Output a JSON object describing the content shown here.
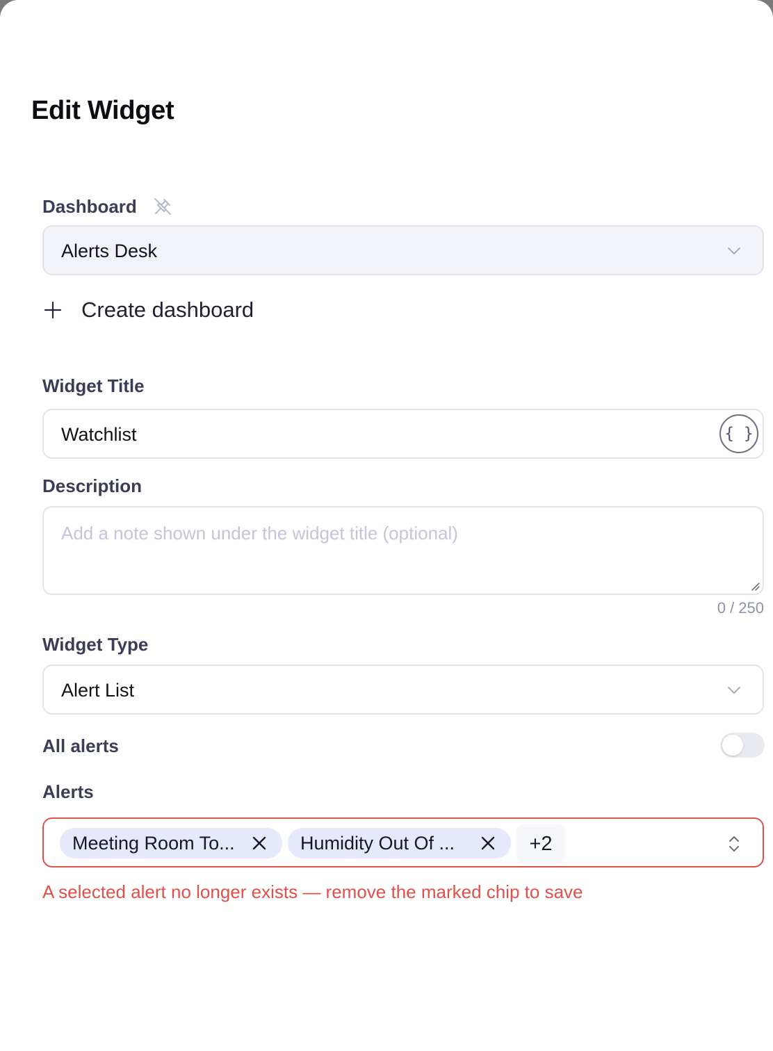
{
  "header": {
    "title": "Edit Widget"
  },
  "dashboard": {
    "label": "Dashboard",
    "label_icon": "unpin-icon",
    "selected": "Alerts Desk",
    "create_label": "Create dashboard"
  },
  "widget_title": {
    "label": "Widget Title",
    "value": "Watchlist",
    "variables_button": "{ }"
  },
  "description": {
    "label": "Description",
    "placeholder": "Add a note shown under the widget title (optional)",
    "counter": "0 / 250"
  },
  "widget_type": {
    "label": "Widget Type",
    "selected": "Alert List"
  },
  "all_alerts": {
    "label": "All alerts",
    "enabled": false
  },
  "alerts": {
    "label": "Alerts",
    "chips": [
      "Meeting Room To...",
      "Humidity Out Of ..."
    ],
    "more": "+2",
    "error": "A selected alert no longer exists — remove the marked chip to save"
  },
  "colors": {
    "error": "#e0504a",
    "chip_bg": "#e6e8fb",
    "text": "#111218"
  }
}
